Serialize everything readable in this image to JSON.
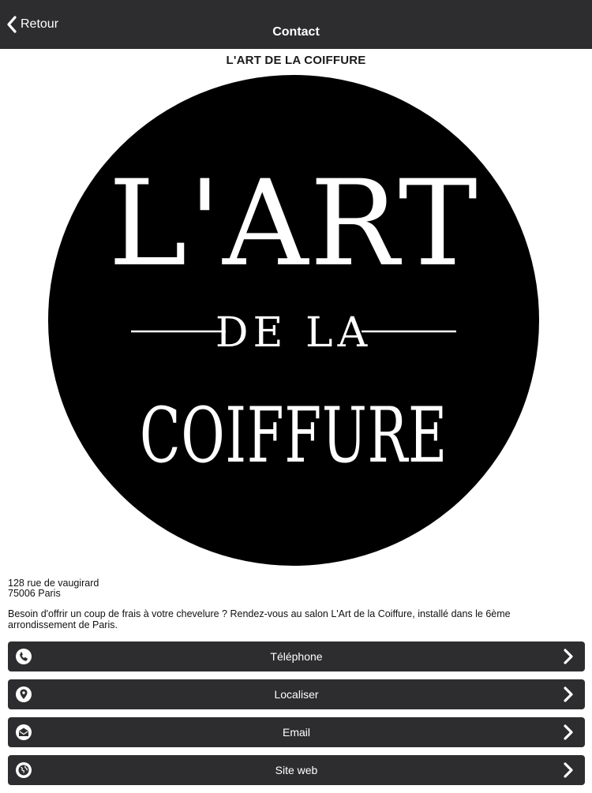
{
  "navbar": {
    "back_label": "Retour",
    "title": "Contact"
  },
  "salon": {
    "title": "L'ART DE LA COIFFURE",
    "logo_text": {
      "line1": "L'ART",
      "line2": "DE LA",
      "line3": "COIFFURE"
    },
    "address_line1": "128 rue de vaugirard",
    "address_line2": "75006 Paris",
    "description": "Besoin d'offrir un coup de frais à votre chevelure ? Rendez-vous au salon L'Art de la Coiffure, installé dans le 6ème arrondissement de Paris."
  },
  "actions": [
    {
      "label": "Téléphone",
      "icon": "phone-icon"
    },
    {
      "label": "Localiser",
      "icon": "location-pin-icon"
    },
    {
      "label": "Email",
      "icon": "email-icon"
    },
    {
      "label": "Site web",
      "icon": "globe-icon"
    }
  ],
  "colors": {
    "bar_background": "#2d2d2f",
    "logo_background": "#000000",
    "text_light": "#ffffff"
  }
}
